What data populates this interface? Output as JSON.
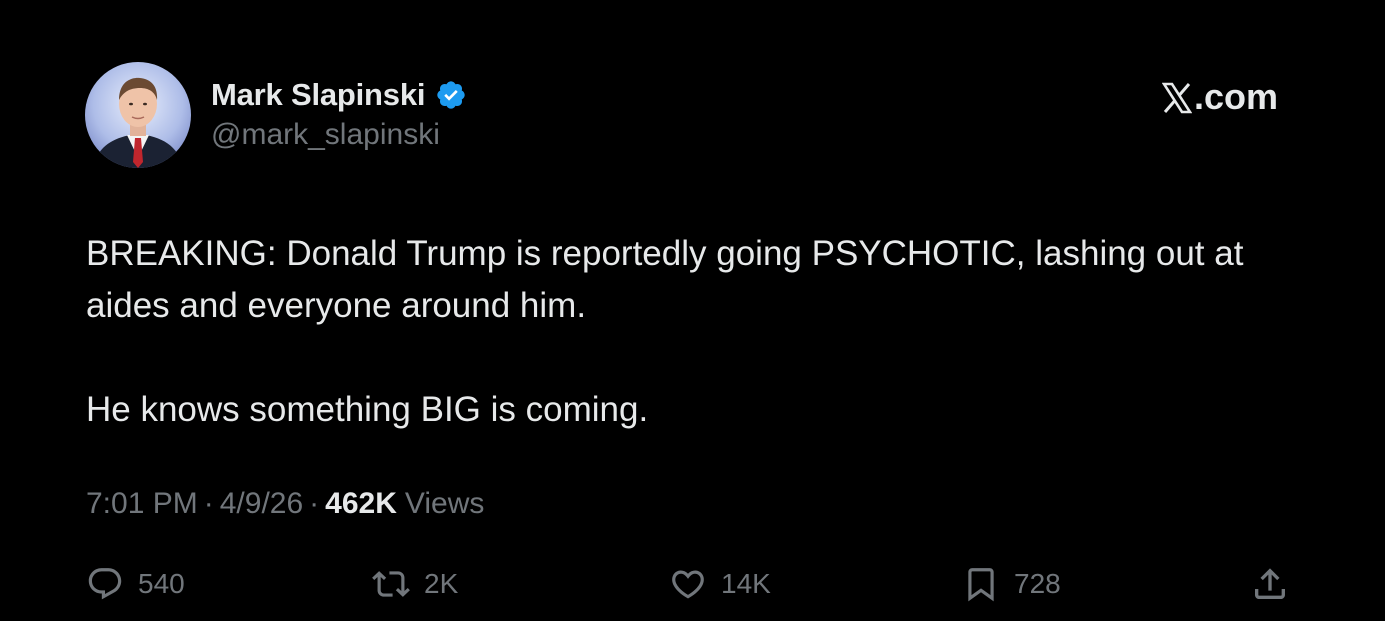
{
  "author": {
    "name": "Mark Slapinski",
    "handle": "@mark_slapinski",
    "verified": true,
    "verified_color": "#1d9bf0"
  },
  "brand": {
    "label": ".com",
    "icon": "x-logo-icon"
  },
  "tweet": {
    "paragraphs": [
      "BREAKING: Donald Trump is reportedly going PSYCHOTIC, lashing out at aides and everyone around him.",
      "He knows something BIG is coming."
    ]
  },
  "meta": {
    "time": "7:01 PM",
    "separator": "·",
    "date": "4/9/26",
    "views_count": "462K",
    "views_label": "Views"
  },
  "actions": {
    "replies": {
      "icon": "reply-icon",
      "count": "540"
    },
    "reposts": {
      "icon": "repost-icon",
      "count": "2K"
    },
    "likes": {
      "icon": "heart-icon",
      "count": "14K"
    },
    "bookmarks": {
      "icon": "bookmark-icon",
      "count": "728"
    },
    "share": {
      "icon": "share-icon"
    }
  },
  "colors": {
    "background": "#000000",
    "primary_text": "#e7e9ea",
    "secondary_text": "#71767b"
  }
}
